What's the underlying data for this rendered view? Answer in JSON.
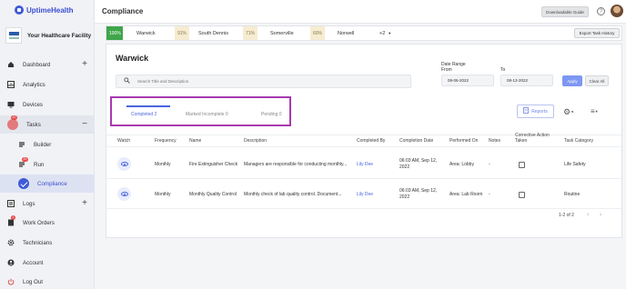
{
  "brand": {
    "name": "UptimeHealth"
  },
  "facility": {
    "name": "Your Healthcare Facility"
  },
  "sidebar": {
    "items": [
      {
        "label": "Dashboard"
      },
      {
        "label": "Analytics"
      },
      {
        "label": "Devices"
      },
      {
        "label": "Tasks",
        "badge": "20"
      },
      {
        "label": "Builder"
      },
      {
        "label": "Run",
        "badge": "20"
      },
      {
        "label": "Compliance"
      },
      {
        "label": "Logs"
      },
      {
        "label": "Work Orders",
        "badge": "1"
      },
      {
        "label": "Technicians"
      },
      {
        "label": "Account"
      },
      {
        "label": "Log Out"
      }
    ]
  },
  "header": {
    "title": "Compliance",
    "guide_label": "Downloadable Guide",
    "help_glyph": "?"
  },
  "locations": {
    "items": [
      {
        "pct": "100%",
        "name": "Warwick",
        "color": "#3fa64a"
      },
      {
        "pct": "91%",
        "name": "South Dennis",
        "color": "#f3e7c8"
      },
      {
        "pct": "71%",
        "name": "Somerville",
        "color": "#f3e7c8"
      },
      {
        "pct": "60%",
        "name": "Norwell",
        "color": "#f3e7c8"
      }
    ],
    "more_label": "+2",
    "export_label": "Export Task History"
  },
  "main": {
    "location_title": "Warwick",
    "search_placeholder": "Search Title and Description",
    "date_range_label": "Date Range",
    "from_label": "From",
    "to_label": "To",
    "from_date": "08-06-2022",
    "to_date": "08-13-2022",
    "apply_label": "Apply",
    "clear_label": "Clear All",
    "tabs": [
      {
        "label": "Completed 2"
      },
      {
        "label": "Marked Incomplete 0"
      },
      {
        "label": "Pending 0"
      }
    ],
    "reports_label": "Reports"
  },
  "table": {
    "headers": [
      "Watch",
      "Frequency",
      "Name",
      "Description",
      "Completed By",
      "Completion Date",
      "Performed On",
      "Notes",
      "Corrective Action Taken",
      "Task Category"
    ],
    "rows": [
      {
        "frequency": "Monthly",
        "name": "Fire Extinguisher Check",
        "description": "Managers are responsible for conducting monthly...",
        "completed_by": "Lily Dee",
        "completion_date": "06:03 AM, Sep 12, 2022",
        "performed_on": "Area: Lobby",
        "notes": "-",
        "category": "Life Safety"
      },
      {
        "frequency": "Monthly",
        "name": "Monthly Quality Control",
        "description": "Monthly check of lab quality control. Document...",
        "completed_by": "Lily Dee",
        "completion_date": "06:03 AM, Sep 12, 2022",
        "performed_on": "Area: Lab Room",
        "notes": "-",
        "category": "Routine"
      }
    ],
    "pagination": "1-2 of 2"
  }
}
